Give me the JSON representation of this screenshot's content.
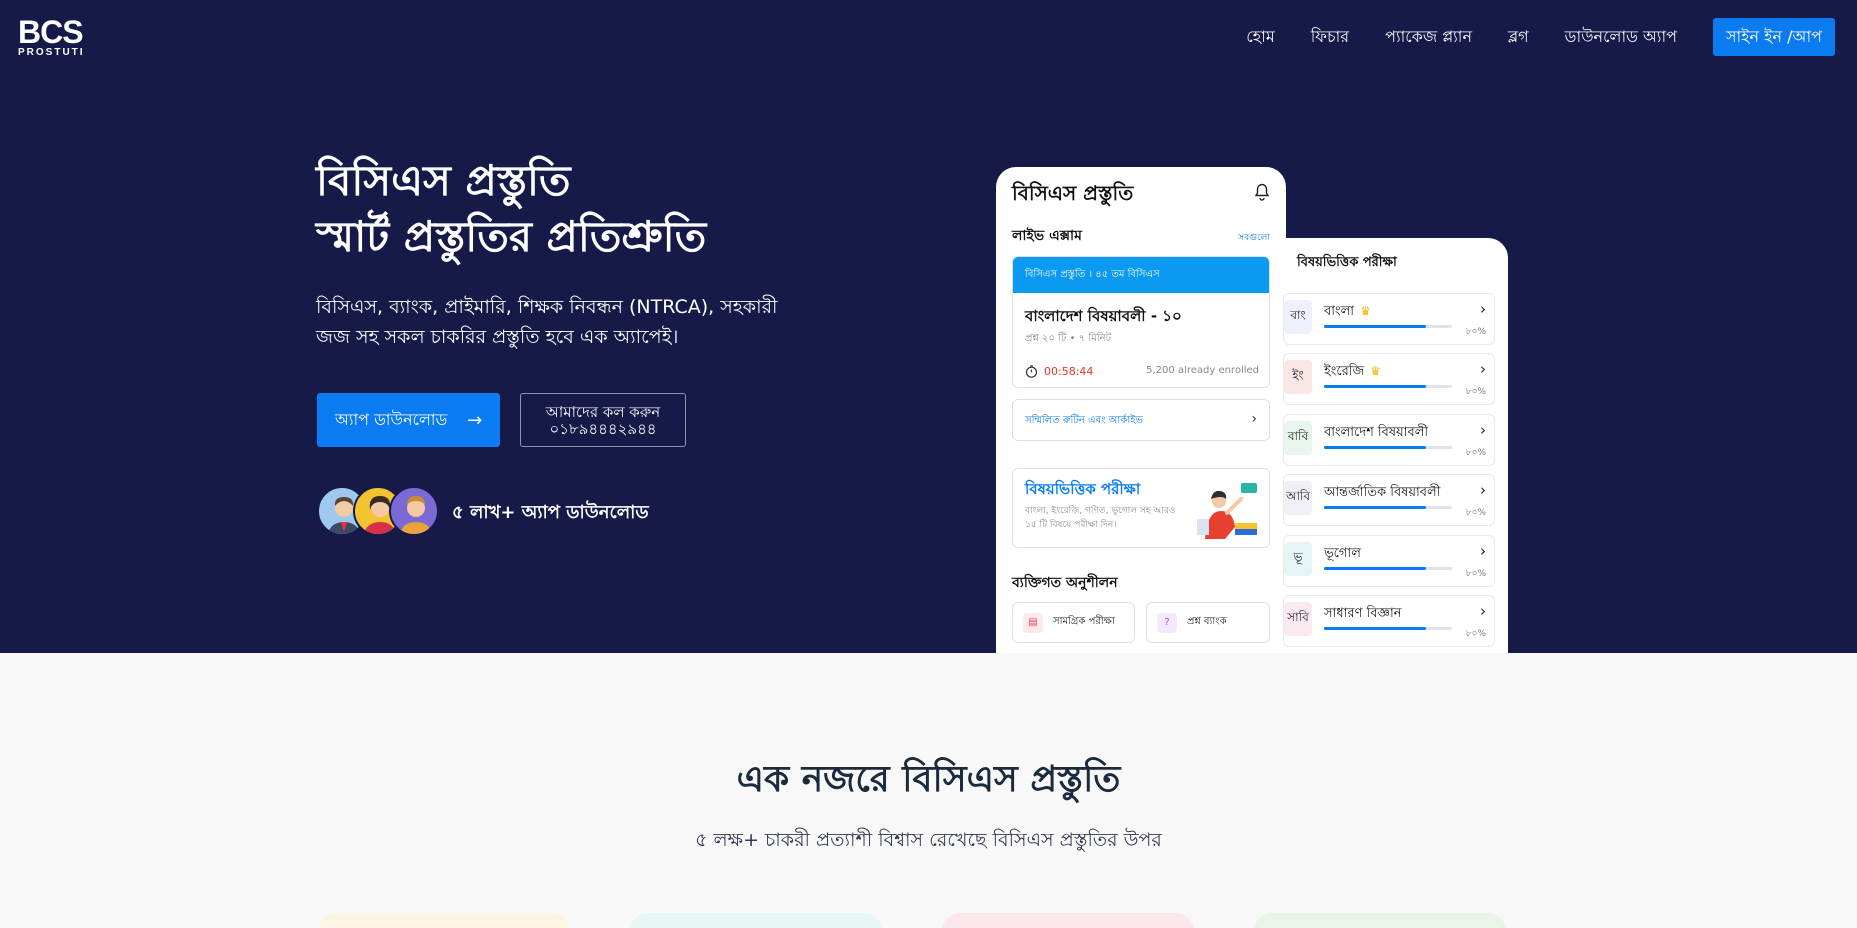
{
  "logo": {
    "mark": "BCS",
    "sub": "PROSTUTI"
  },
  "nav": {
    "items": [
      {
        "label": "হোম"
      },
      {
        "label": "ফিচার"
      },
      {
        "label": "প্যাকেজ প্ল্যান"
      },
      {
        "label": "ব্লগ"
      },
      {
        "label": "ডাউনলোড অ্যাপ"
      }
    ],
    "cta": "সাইন ইন /আপ"
  },
  "hero": {
    "title_line1": "বিসিএস প্রস্তুতি",
    "title_line2": "স্মার্ট প্রস্তুতির প্রতিশ্রুতি",
    "desc_line1": "বিসিএস, ব্যাংক, প্রাইমারি, শিক্ষক নিবন্ধন (NTRCA), সহকারী",
    "desc_line2": "জজ সহ সকল চাকরির প্রস্তুতি হবে এক অ্যাপেই।",
    "download_btn": "অ্যাপ ডাউনলোড",
    "call_label": "আমাদের কল করুন",
    "call_number": "০১৮৯৪৪৪২৯৪৪",
    "downloads_text": "৫ লাখ+ অ্যাপ ডাউনলোড"
  },
  "phone1": {
    "title": "বিসিএস প্রস্তুতি",
    "live_exam": "লাইভ এক্সাম",
    "see_all": "সবগুলো",
    "exam_header": "বিসিএস প্রস্তুতি । ৪৫ তম বিসিএস",
    "exam_name": "বাংলাদেশ বিষয়াবলী - ১০",
    "exam_meta": "প্রশ্ন ২০ টি • ৭ মিনিট",
    "timer": "00:58:44",
    "enrolled": "5,200 already enrolled",
    "routine": "সম্মিলিত রুটিন এবং আর্কাইভ",
    "subject_title": "বিষয়ভিত্তিক পরীক্ষা",
    "subject_desc": "বাংলা, ইংরেজি, গণিত, ভূগোল সহ আরও ১৫ টি বিষয়ে পরীক্ষা দিন।",
    "practice_title": "ব্যক্তিগত অনুশীলন",
    "practice_items": [
      {
        "label": "সামগ্রিক পরীক্ষা"
      },
      {
        "label": "প্রশ্ন ব্যাংক"
      }
    ]
  },
  "phone2": {
    "title": "বিষয়ভিত্তিক পরীক্ষা",
    "subjects": [
      {
        "icon": "বাং",
        "name": "বাংলা",
        "premium": true,
        "progress": 0.8,
        "pct": "৮০%",
        "color": "#eef0fb"
      },
      {
        "icon": "ইং",
        "name": "ইংরেজি",
        "premium": true,
        "progress": 0.8,
        "pct": "৮০%",
        "color": "#fbe6e6"
      },
      {
        "icon": "বাবি",
        "name": "বাংলাদেশ বিষয়াবলী",
        "premium": false,
        "progress": 0.8,
        "pct": "৮০%",
        "color": "#e8f5ec"
      },
      {
        "icon": "আবি",
        "name": "আন্তর্জাতিক বিষয়াবলী",
        "premium": false,
        "progress": 0.8,
        "pct": "৮০%",
        "color": "#f0eef6"
      },
      {
        "icon": "ভূ",
        "name": "ভূগোল",
        "premium": false,
        "progress": 0.8,
        "pct": "৮০%",
        "color": "#e6f4f8"
      },
      {
        "icon": "সাবি",
        "name": "সাধারণ বিজ্ঞান",
        "premium": false,
        "progress": 0.8,
        "pct": "৮০%",
        "color": "#fbe9f2"
      }
    ]
  },
  "section2": {
    "title": "এক নজরে বিসিএস প্রস্তুতি",
    "subtitle": "৫ লক্ষ+ চাকরী প্রত্যাশী বিশ্বাস রেখেছে বিসিএস প্রস্তুতির উপর"
  },
  "colors": {
    "hero_bg": "#161a48",
    "primary": "#0b7bf2",
    "timer": "#e0362c"
  }
}
